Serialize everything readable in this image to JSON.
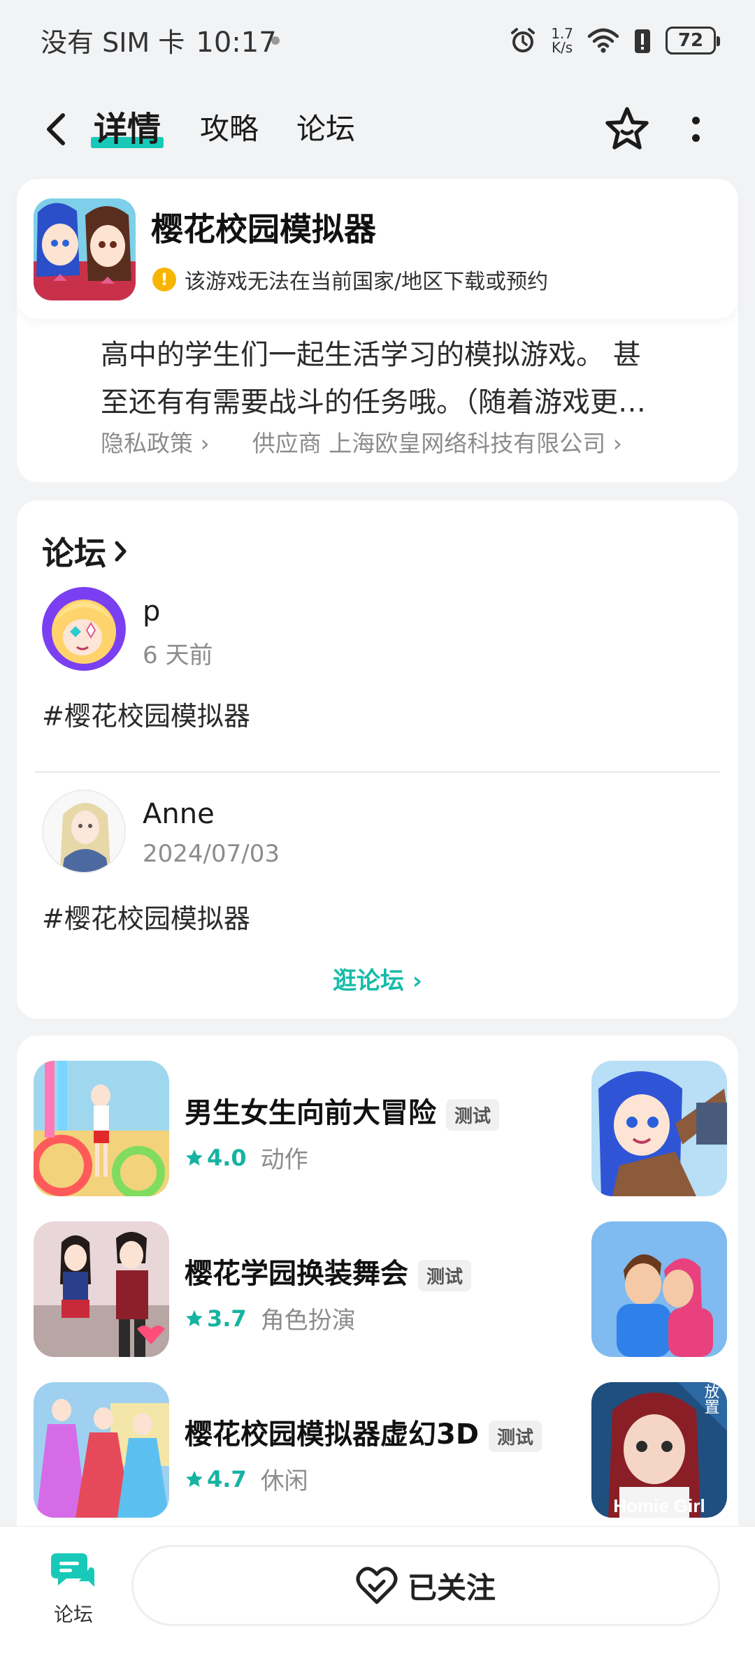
{
  "status_bar": {
    "carrier": "没有 SIM 卡",
    "time": "10:17",
    "net_speed_value": "1.7",
    "net_speed_unit": "K/s",
    "battery": "72",
    "icons": [
      "alarm-icon",
      "wifi-icon",
      "battery-alert-icon",
      "battery-icon"
    ]
  },
  "nav": {
    "tabs": [
      {
        "label": "详情",
        "active": true
      },
      {
        "label": "攻略",
        "active": false
      },
      {
        "label": "论坛",
        "active": false
      }
    ],
    "accent": "#18c9b8"
  },
  "app": {
    "title": "樱花校园模拟器",
    "region_note": "该游戏无法在当前国家/地区下载或预约",
    "description_line1": "高中的学生们一起生活学习的模拟游戏。 甚",
    "description_line2": "至还有有需要战斗的任务哦。（随着游戏更…",
    "privacy_link": "隐私政策",
    "vendor_label": "供应商",
    "vendor_name": "上海欧皇网络科技有限公司"
  },
  "forum": {
    "title": "论坛",
    "posts": [
      {
        "author": "p",
        "time": "6 天前",
        "body": "#樱花校园模拟器"
      },
      {
        "author": "Anne",
        "time": "2024/07/03",
        "body": "#樱花校园模拟器"
      }
    ],
    "browse_label": "逛论坛"
  },
  "recommendations": [
    {
      "name": "男生女生向前大冒险",
      "badge": "测试",
      "rating": "4.0",
      "genre": "动作"
    },
    {
      "name": "樱花学园换装舞会",
      "badge": "测试",
      "rating": "3.7",
      "genre": "角色扮演"
    },
    {
      "name": "樱花校园模拟器虚幻3D",
      "badge": "测试",
      "rating": "4.7",
      "genre": "休闲"
    }
  ],
  "side_thumb_texts": {
    "third_badge": "放置",
    "third_logo": "Homie Girl"
  },
  "bottom_bar": {
    "forum_label": "论坛",
    "follow_label": "已关注"
  },
  "colors": {
    "accent": "#18c9b8",
    "rating": "#15b3a2",
    "warning": "#f7b500"
  }
}
